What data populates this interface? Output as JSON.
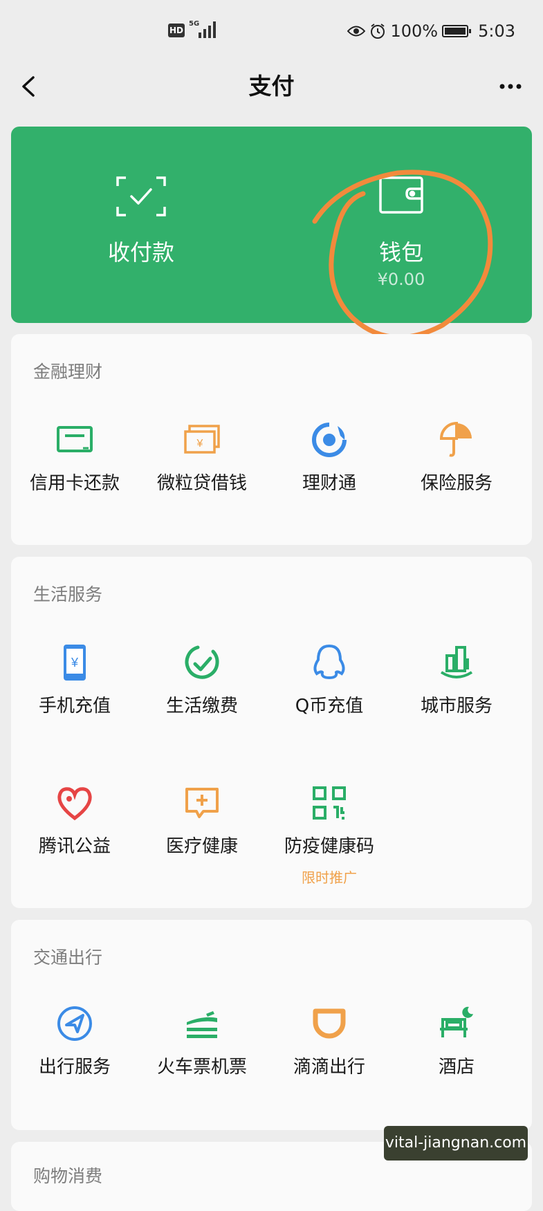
{
  "status_bar": {
    "hd": "HD",
    "network": "5G",
    "battery": "100%",
    "time": "5:03"
  },
  "nav": {
    "title": "支付"
  },
  "top_card": {
    "collect": {
      "label": "收付款",
      "icon": "scan-qr-icon"
    },
    "wallet": {
      "label": "钱包",
      "amount": "¥0.00",
      "icon": "wallet-icon"
    }
  },
  "sections": {
    "finance": {
      "title": "金融理财",
      "items": [
        {
          "label": "信用卡还款",
          "icon": "credit-card-icon",
          "color": "#2aae67"
        },
        {
          "label": "微粒贷借钱",
          "icon": "cash-icon",
          "color": "#f0a14a"
        },
        {
          "label": "理财通",
          "icon": "wealth-icon",
          "color": "#3b8be6"
        },
        {
          "label": "保险服务",
          "icon": "insurance-icon",
          "color": "#f0a14a"
        }
      ]
    },
    "life": {
      "title": "生活服务",
      "items": [
        {
          "label": "手机充值",
          "icon": "phone-topup-icon",
          "color": "#3b8be6"
        },
        {
          "label": "生活缴费",
          "icon": "bill-payment-icon",
          "color": "#2aae67"
        },
        {
          "label": "Q币充值",
          "icon": "qq-coin-icon",
          "color": "#3b8be6"
        },
        {
          "label": "城市服务",
          "icon": "city-service-icon",
          "color": "#2aae67"
        },
        {
          "label": "腾讯公益",
          "icon": "charity-heart-icon",
          "color": "#e64545"
        },
        {
          "label": "医疗健康",
          "icon": "medical-icon",
          "color": "#f0a14a"
        },
        {
          "label": "防疫健康码",
          "sub": "限时推广",
          "icon": "health-code-icon",
          "color": "#2aae67"
        }
      ]
    },
    "transport": {
      "title": "交通出行",
      "items": [
        {
          "label": "出行服务",
          "icon": "navigation-icon",
          "color": "#3b8be6"
        },
        {
          "label": "火车票机票",
          "icon": "train-plane-icon",
          "color": "#2aae67"
        },
        {
          "label": "滴滴出行",
          "icon": "didi-icon",
          "color": "#f0a14a"
        },
        {
          "label": "酒店",
          "icon": "hotel-bed-icon",
          "color": "#2aae67"
        }
      ]
    },
    "shopping": {
      "title": "购物消费"
    }
  },
  "watermark": "vital-jiangnan.com",
  "colors": {
    "brand_green": "#32b06b",
    "annotation_orange": "#f28a3c"
  }
}
